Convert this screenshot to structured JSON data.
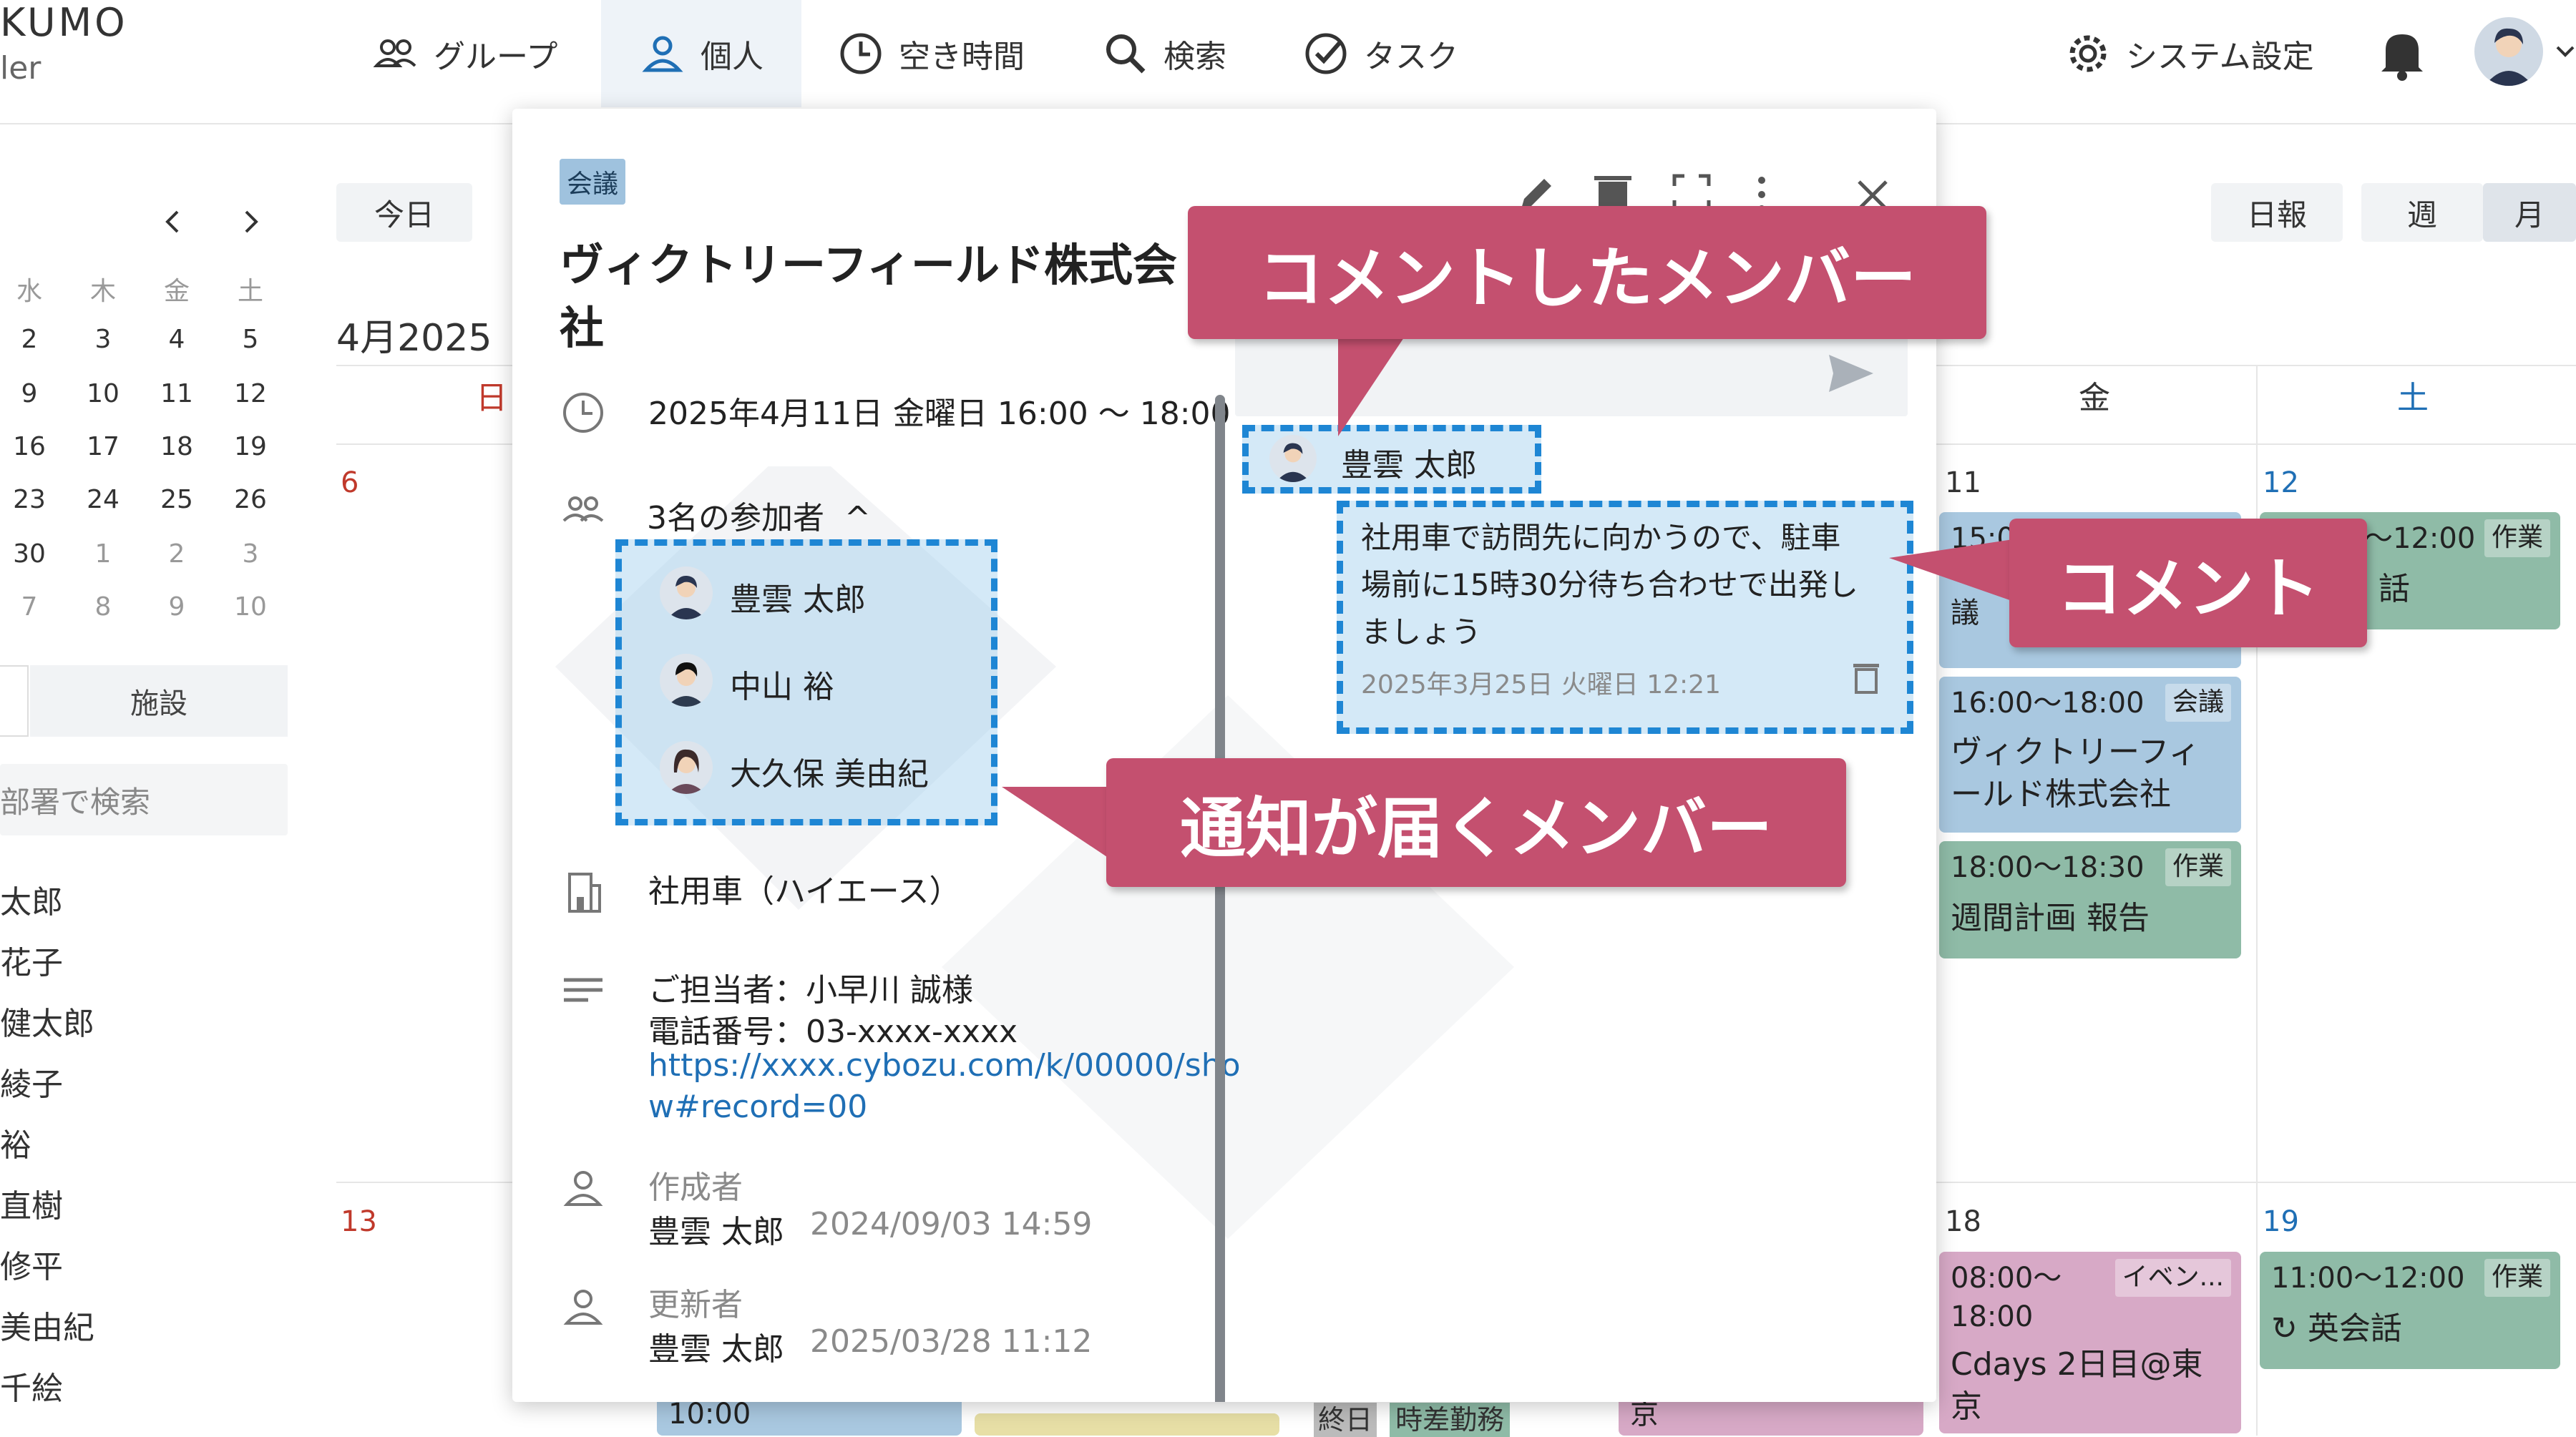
{
  "app": {
    "brand_top": "KUMO",
    "brand_bottom": "ler"
  },
  "nav": [
    {
      "label": "グループ",
      "icon": "group-icon"
    },
    {
      "label": "個人",
      "icon": "person-icon"
    },
    {
      "label": "空き時間",
      "icon": "clock-icon"
    },
    {
      "label": "検索",
      "icon": "search-icon"
    },
    {
      "label": "タスク",
      "icon": "check-circle-icon"
    }
  ],
  "header_right": {
    "settings_label": "システム設定"
  },
  "toolbar": {
    "today": "今日",
    "daily": "日報",
    "week": "週",
    "month": "月"
  },
  "mini_calendar": {
    "weekdays": [
      "水",
      "木",
      "金",
      "土"
    ],
    "rows": [
      [
        "2",
        "3",
        "4",
        "5"
      ],
      [
        "9",
        "10",
        "11",
        "12"
      ],
      [
        "16",
        "17",
        "18",
        "19"
      ],
      [
        "23",
        "24",
        "25",
        "26"
      ],
      [
        "30",
        "1",
        "2",
        "3"
      ],
      [
        "7",
        "8",
        "9",
        "10"
      ]
    ]
  },
  "sidebar": {
    "tab_facility": "施設",
    "search_placeholder": "部署で検索",
    "members": [
      "太郎",
      "花子",
      "健太郎",
      "綾子",
      "裕",
      "直樹",
      "修平",
      "美由紀",
      "千絵"
    ]
  },
  "calendar": {
    "month_label": "4月2025",
    "col_sun": "日",
    "col_fri": "金",
    "col_sat": "土",
    "days": {
      "d6": "6",
      "d11": "11",
      "d12": "12",
      "d13": "13",
      "d18": "18",
      "d19": "19"
    },
    "events": {
      "e1_time": "15:0",
      "e1_text": "議",
      "e2_time": "16:00〜18:00",
      "e2_tag": "会議",
      "e2_title": "ヴィクトリーフィールド株式会社",
      "e3_time": "18:00〜18:30",
      "e3_tag": "作業",
      "e3_title": "週間計画 報告",
      "e4_time": "〜12:00",
      "e4_tag": "作業",
      "e4_title": "話",
      "e5_time": "08:00〜18:00",
      "e5_tag": "イベン...",
      "e5_title": "Cdays 2日目@東京",
      "e6_time": "11:00〜12:00",
      "e6_tag": "作業",
      "e6_title": "英会話",
      "bottom1": "10:00",
      "bottom2a": "終日",
      "bottom2b": "時差勤務",
      "bottom3": "京"
    }
  },
  "modal": {
    "category": "会議",
    "title_line1": "ヴィクトリーフィールド株式会",
    "title_line2": "社",
    "datetime": "2025年4月11日 金曜日 16:00 〜 18:00",
    "participants_label": "3名の参加者",
    "participants": [
      "豊雲 太郎",
      "中山 裕",
      "大久保 美由紀"
    ],
    "facility": "社用車（ハイエース）",
    "memo_line1": "ご担当者：小早川 誠様",
    "memo_line2": "電話番号：03-xxxx-xxxx",
    "memo_link1": "https://xxxx.cybozu.com/k/00000/sho",
    "memo_link2": "w#record=00",
    "creator_label": "作成者",
    "creator_name": "豊雲 太郎",
    "creator_date": "2024/09/03 14:59",
    "updater_label": "更新者",
    "updater_name": "豊雲 太郎",
    "updater_date": "2025/03/28 11:12",
    "comment_author": "豊雲 太郎",
    "comment_line1": "社用車で訪問先に向かうので、駐車",
    "comment_line2": "場前に15時30分待ち合わせで出発し",
    "comment_line3": "ましょう",
    "comment_date": "2025年3月25日 火曜日 12:21"
  },
  "callouts": {
    "commenter": "コメントしたメンバー",
    "comment": "コメント",
    "notified": "通知が届くメンバー"
  },
  "colors": {
    "callout": "#c4506f",
    "dashed": "#1e86d4",
    "accent": "#1f6fb5"
  }
}
